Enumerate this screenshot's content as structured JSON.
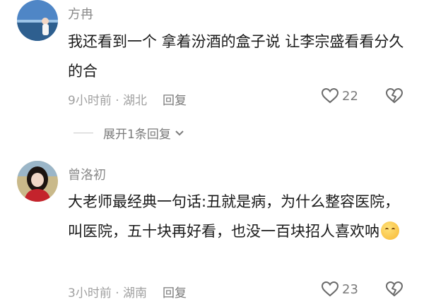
{
  "comments": [
    {
      "username": "方冉",
      "content": "我还看到一个 拿着汾酒的盒子说 让李宗盛看看分久的合",
      "time_location": "9小时前 · 湖北",
      "reply_label": "回复",
      "likes": "22",
      "expand_label": "展开1条回复"
    },
    {
      "username": "曾洛初",
      "content": "大老师最经典一句话:丑就是病，为什么整容医院，叫医院，五十块再好看，也没一百块招人喜欢呐",
      "time_location": "3小时前 · 湖南",
      "reply_label": "回复",
      "likes": "23"
    }
  ],
  "icons": {
    "like": "heart-outline-icon",
    "dislike": "broken-heart-icon",
    "expand": "chevron-down-icon",
    "emoji": "smirk-emoji-icon"
  },
  "colors": {
    "username": "#8a8a8a",
    "meta": "#a0a0a0",
    "text": "#1a1a1a"
  }
}
